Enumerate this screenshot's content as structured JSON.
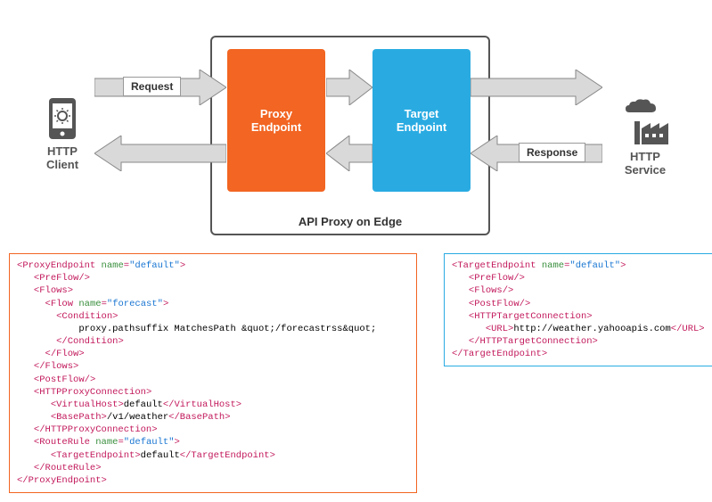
{
  "diagram": {
    "client_label": "HTTP\nClient",
    "service_label": "HTTP\nService",
    "container_label": "API Proxy on Edge",
    "proxy_endpoint_label": "Proxy\nEndpoint",
    "target_endpoint_label": "Target\nEndpoint",
    "request_label": "Request",
    "response_label": "Response"
  },
  "proxy_xml": {
    "root_tag": "ProxyEndpoint",
    "root_attr_name": "name",
    "root_attr_val": "default",
    "preflow": "PreFlow",
    "flows": "Flows",
    "flow_tag": "Flow",
    "flow_attr_name": "name",
    "flow_attr_val": "forecast",
    "condition_tag": "Condition",
    "condition_text": "proxy.pathsuffix MatchesPath &quot;/forecastrss&quot;",
    "postflow": "PostFlow",
    "http_conn": "HTTPProxyConnection",
    "vhost_tag": "VirtualHost",
    "vhost_val": "default",
    "basepath_tag": "BasePath",
    "basepath_val": "/v1/weather",
    "routerule_tag": "RouteRule",
    "routerule_attr_name": "name",
    "routerule_attr_val": "default",
    "target_ep_tag": "TargetEndpoint",
    "target_ep_val": "default"
  },
  "target_xml": {
    "root_tag": "TargetEndpoint",
    "root_attr_name": "name",
    "root_attr_val": "default",
    "preflow": "PreFlow",
    "flows": "Flows",
    "postflow": "PostFlow",
    "http_conn": "HTTPTargetConnection",
    "url_tag": "URL",
    "url_val": "http://weather.yahooapis.com"
  }
}
